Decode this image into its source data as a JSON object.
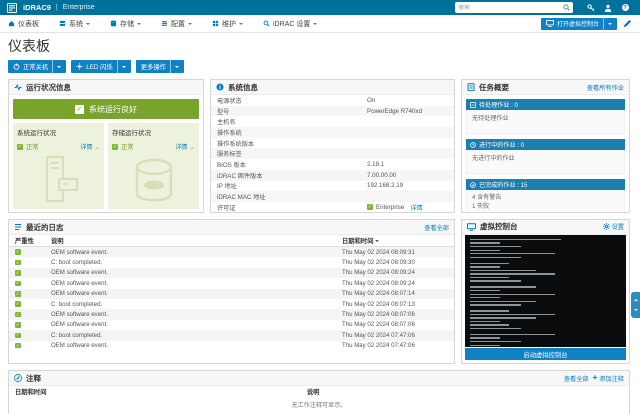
{
  "masthead": {
    "brand": "iDRAC9",
    "edition": "Enterprise",
    "search_placeholder": "搜索",
    "icons": [
      "key-icon",
      "user-icon",
      "help-icon"
    ]
  },
  "nav": {
    "items": [
      {
        "label": "仪表板",
        "icon": "home-icon"
      },
      {
        "label": "系统",
        "icon": "server-icon"
      },
      {
        "label": "存储",
        "icon": "storage-icon"
      },
      {
        "label": "配置",
        "icon": "config-icon"
      },
      {
        "label": "维护",
        "icon": "maintenance-icon"
      },
      {
        "label": "iDRAC 设置",
        "icon": "idrac-settings-icon"
      }
    ],
    "console_button": "打开虚拟控制台"
  },
  "page": {
    "title": "仪表板",
    "actions": {
      "shutdown": "正常关机",
      "led": "LED 闪烁",
      "more": "更多操作"
    }
  },
  "health": {
    "title": "运行状况信息",
    "banner": "系统运行良好",
    "cards": [
      {
        "title": "系统运行状况",
        "status": "正常",
        "link": "详情",
        "icon": "server-tower-icon"
      },
      {
        "title": "存储运行状况",
        "status": "正常",
        "link": "详情",
        "icon": "storage-disk-icon"
      }
    ]
  },
  "system_info": {
    "title": "系统信息",
    "rows": [
      {
        "label": "电源状态",
        "value": "On"
      },
      {
        "label": "型号",
        "value": "PowerEdge R740xd"
      },
      {
        "label": "主机名",
        "value": ""
      },
      {
        "label": "操作系统",
        "value": ""
      },
      {
        "label": "操作系统版本",
        "value": ""
      },
      {
        "label": "服务标签",
        "value": ""
      },
      {
        "label": "BIOS 版本",
        "value": "2.19.1"
      },
      {
        "label": "iDRAC 固件版本",
        "value": "7.00.00.00"
      },
      {
        "label": "IP 地址",
        "value": "192.168.2.19"
      },
      {
        "label": "iDRAC MAC 地址",
        "value": ""
      }
    ],
    "license": {
      "label": "许可证",
      "value": "Enterprise",
      "link": "详情"
    }
  },
  "jobs": {
    "title": "任务概要",
    "view_all": "查看所有作业",
    "sections": [
      {
        "title": "待处理作业 : 0",
        "body": "无待处理作业"
      },
      {
        "title": "进行中的作业 : 0",
        "body": "无进行中的作业"
      },
      {
        "title": "已完成的作业 : 15",
        "lines": [
          "4 含有警告",
          "1 失败"
        ]
      }
    ]
  },
  "logs": {
    "title": "最近的日志",
    "view_all": "查看全部",
    "columns": [
      "严重性",
      "说明",
      "日期和时间"
    ],
    "rows": [
      {
        "severity": "ok",
        "desc": "OEM software event.",
        "time": "Thu May 02 2024 08:09:31"
      },
      {
        "severity": "ok",
        "desc": "C: boot completed.",
        "time": "Thu May 02 2024 08:09:30"
      },
      {
        "severity": "ok",
        "desc": "OEM software event.",
        "time": "Thu May 02 2024 08:09:24"
      },
      {
        "severity": "ok",
        "desc": "OEM software event.",
        "time": "Thu May 02 2024 08:09:24"
      },
      {
        "severity": "ok",
        "desc": "OEM software event.",
        "time": "Thu May 02 2024 08:07:14"
      },
      {
        "severity": "ok",
        "desc": "C: boot completed.",
        "time": "Thu May 02 2024 08:07:13"
      },
      {
        "severity": "ok",
        "desc": "OEM software event.",
        "time": "Thu May 02 2024 08:07:06"
      },
      {
        "severity": "ok",
        "desc": "OEM software event.",
        "time": "Thu May 02 2024 08:07:06"
      },
      {
        "severity": "ok",
        "desc": "C: boot completed.",
        "time": "Thu May 02 2024 07:47:06"
      },
      {
        "severity": "ok",
        "desc": "OEM software event.",
        "time": "Thu May 02 2024 07:47:06"
      }
    ]
  },
  "console": {
    "title": "虚拟控制台",
    "settings": "设置",
    "launch": "启动虚拟控制台"
  },
  "notes": {
    "title": "注释",
    "view_all": "查看全部",
    "add": "添加注释",
    "columns": [
      "日期和时间",
      "说明"
    ],
    "empty": "无工作注释可显示。"
  },
  "colors": {
    "primary": "#007db8",
    "masthead": "#00719c",
    "button": "#1081c2",
    "job_section_header": "#1b7fb0",
    "banner_green": "#78a32d",
    "card_green": "#edf2dc",
    "status_green": "#7fb539"
  }
}
